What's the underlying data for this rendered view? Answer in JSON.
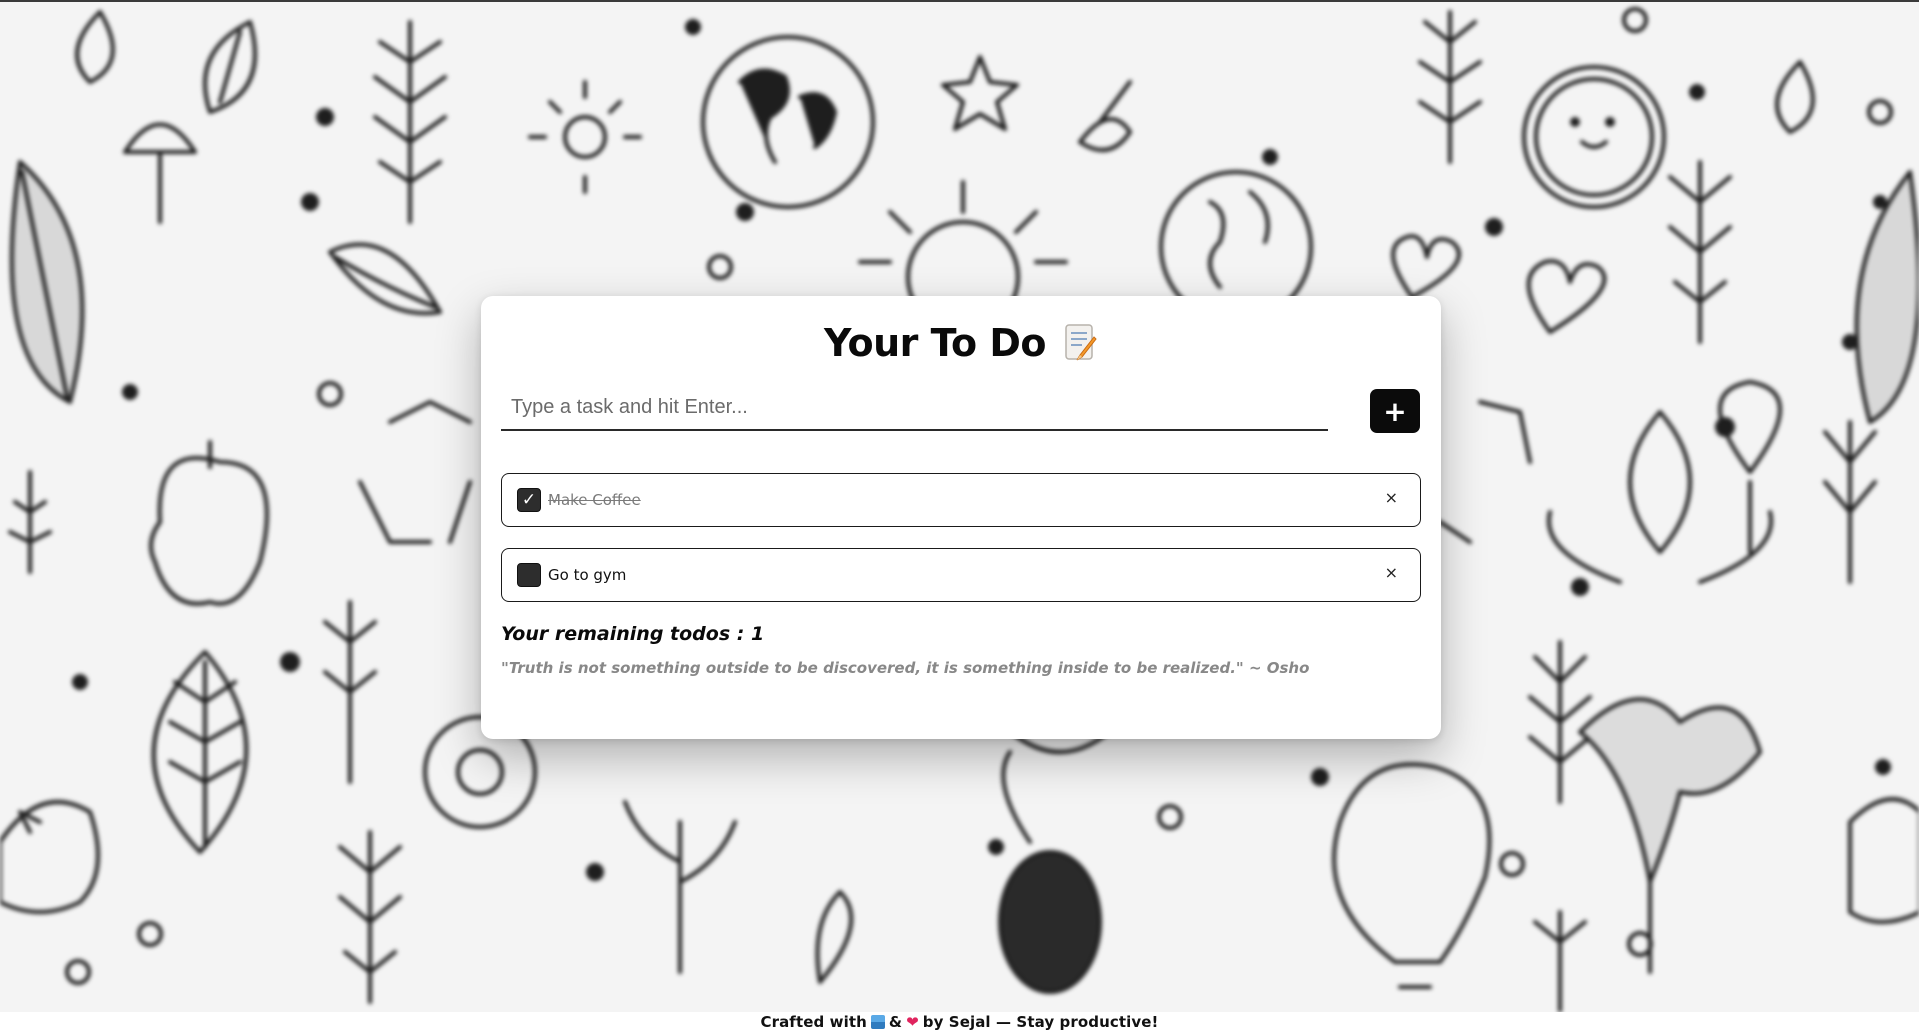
{
  "app": {
    "title": "Your To Do",
    "title_icon": "memo-icon"
  },
  "input": {
    "placeholder": "Type a task and hit Enter...",
    "value": "",
    "add_label": "+"
  },
  "todos": [
    {
      "text": "Make Coffee",
      "done": true,
      "check_mark": "✓",
      "remove_label": "×"
    },
    {
      "text": "Go to gym",
      "done": false,
      "check_mark": "",
      "remove_label": "×"
    }
  ],
  "summary": {
    "remaining_text": "Your remaining todos : 1",
    "quote": "\"Truth is not something outside to be discovered, it is something inside to be realized.\" ~ Osho"
  },
  "footer": {
    "crafted": "Crafted with",
    "amp": "&",
    "by": "by Sejal — Stay productive!",
    "icons": [
      "book-icon",
      "heart-icon"
    ]
  },
  "colors": {
    "accent": "#0b0b0b",
    "card_bg": "#ffffff",
    "muted_text": "#888888",
    "heart": "#e0245e"
  }
}
